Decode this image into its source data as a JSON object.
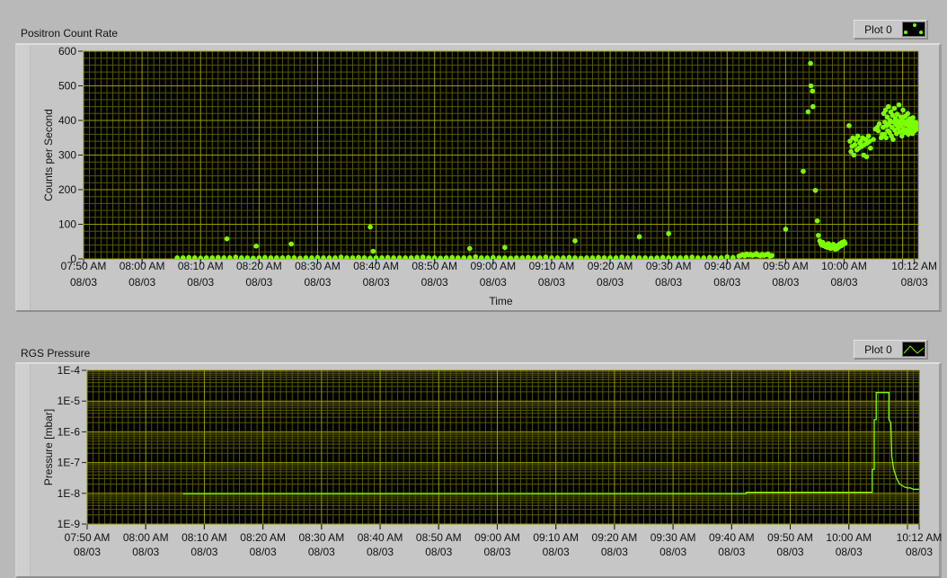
{
  "charts": [
    {
      "title": "Positron Count Rate",
      "legend": {
        "label": "Plot 0",
        "icon": "scatter-points-icon"
      },
      "colors": {
        "plot": "#7cff00",
        "major_grid": "#9c9c00",
        "minor_grid": "#575700",
        "background": "#000000"
      }
    },
    {
      "title": "RGS Pressure",
      "legend": {
        "label": "Plot 0",
        "icon": "line-icon"
      },
      "colors": {
        "plot": "#7cff00",
        "major_grid": "#9c9c00",
        "minor_grid": "#575700",
        "background": "#000000"
      }
    }
  ],
  "chart_data": [
    {
      "type": "scatter",
      "title": "Positron Count Rate",
      "xlabel": "Time",
      "ylabel": "Counts per Second",
      "xlim": [
        "07:50:00",
        "10:12:40"
      ],
      "ylim": [
        0,
        600
      ],
      "y_scale": "linear",
      "y_ticks": [
        "0",
        "100",
        "200",
        "300",
        "400",
        "500",
        "600"
      ],
      "x_ticks": [
        {
          "time": "07:50 AM",
          "date": "08/03"
        },
        {
          "time": "08:00 AM",
          "date": "08/03"
        },
        {
          "time": "08:10 AM",
          "date": "08/03"
        },
        {
          "time": "08:20 AM",
          "date": "08/03"
        },
        {
          "time": "08:30 AM",
          "date": "08/03"
        },
        {
          "time": "08:40 AM",
          "date": "08/03"
        },
        {
          "time": "08:50 AM",
          "date": "08/03"
        },
        {
          "time": "09:00 AM",
          "date": "08/03"
        },
        {
          "time": "09:10 AM",
          "date": "08/03"
        },
        {
          "time": "09:20 AM",
          "date": "08/03"
        },
        {
          "time": "09:30 AM",
          "date": "08/03"
        },
        {
          "time": "09:40 AM",
          "date": "08/03"
        },
        {
          "time": "09:50 AM",
          "date": "08/03"
        },
        {
          "time": "10:00 AM",
          "date": "08/03"
        },
        {
          "time": "10:12 AM",
          "date": "08/03"
        }
      ],
      "grid": true,
      "legend_position": "top-right",
      "series": [
        {
          "name": "Plot 0",
          "regular_segments": [
            {
              "start": "08:06:00",
              "step_s": 60,
              "values": [
                3,
                3,
                4,
                3,
                2,
                3,
                3,
                4,
                3,
                3,
                5,
                3,
                3,
                2,
                3,
                4,
                3,
                3,
                3,
                4,
                3,
                2,
                3,
                3,
                4,
                3,
                3,
                3,
                5,
                3,
                3,
                4,
                3,
                2,
                3,
                3,
                4,
                3,
                3,
                3,
                3,
                4,
                5,
                3,
                3,
                2,
                3,
                4,
                3,
                3,
                3,
                6,
                3,
                3,
                4,
                3,
                3,
                2,
                3,
                3,
                4,
                3,
                3,
                5,
                3,
                3,
                3,
                4,
                3,
                2,
                3,
                3,
                4,
                3,
                3,
                3,
                5,
                3,
                4,
                3,
                3,
                2,
                3,
                4,
                3,
                3,
                3,
                4,
                5,
                3,
                3,
                4,
                3,
                3,
                6,
                4
              ]
            },
            {
              "start": "09:42:00",
              "step_s": 20,
              "values": [
                8,
                10,
                12,
                9,
                14,
                11,
                13,
                10,
                12,
                15,
                11,
                9,
                13,
                10,
                12,
                14,
                8,
                10
              ]
            },
            {
              "start": "10:06:40",
              "step_s": 6,
              "values": [
                380,
                420,
                360,
                395,
                430,
                350,
                385,
                410,
                370,
                440,
                390,
                365,
                400,
                425,
                355,
                380,
                415,
                345,
                395,
                435,
                372,
                405,
                388,
                362,
                418,
                398,
                378,
                445,
                392,
                368,
                410,
                385,
                355,
                402,
                430,
                375,
                395,
                365,
                412,
                388,
                372,
                398,
                420,
                360,
                392,
                380,
                405,
                370,
                398,
                385,
                362,
                408,
                392,
                378,
                370,
                395,
                385,
                375,
                390,
                380
              ]
            }
          ],
          "points": [
            [
              "08:14:30",
              58
            ],
            [
              "08:19:30",
              37
            ],
            [
              "08:25:30",
              43
            ],
            [
              "08:39:00",
              92
            ],
            [
              "08:39:30",
              22
            ],
            [
              "08:56:00",
              30
            ],
            [
              "09:02:00",
              33
            ],
            [
              "09:14:00",
              52
            ],
            [
              "09:25:00",
              64
            ],
            [
              "09:30:00",
              73
            ],
            [
              "09:50:00",
              86
            ],
            [
              "09:53:00",
              253
            ],
            [
              "09:53:50",
              425
            ],
            [
              "09:54:15",
              565
            ],
            [
              "09:54:20",
              500
            ],
            [
              "09:54:35",
              485
            ],
            [
              "09:54:40",
              440
            ],
            [
              "09:55:05",
              198
            ],
            [
              "09:55:25",
              110
            ],
            [
              "09:55:35",
              68
            ],
            [
              "09:55:50",
              52
            ],
            [
              "09:56:00",
              45
            ],
            [
              "09:56:10",
              40
            ],
            [
              "09:56:20",
              48
            ],
            [
              "09:56:30",
              38
            ],
            [
              "09:56:40",
              42
            ],
            [
              "09:56:50",
              35
            ],
            [
              "09:57:00",
              40
            ],
            [
              "09:57:10",
              33
            ],
            [
              "09:57:20",
              44
            ],
            [
              "09:57:30",
              36
            ],
            [
              "09:57:40",
              30
            ],
            [
              "09:57:50",
              38
            ],
            [
              "09:58:00",
              32
            ],
            [
              "09:58:10",
              42
            ],
            [
              "09:58:20",
              34
            ],
            [
              "09:58:30",
              28
            ],
            [
              "09:58:40",
              36
            ],
            [
              "09:58:50",
              30
            ],
            [
              "09:59:00",
              40
            ],
            [
              "09:59:10",
              35
            ],
            [
              "09:59:20",
              44
            ],
            [
              "09:59:30",
              38
            ],
            [
              "09:59:40",
              48
            ],
            [
              "09:59:50",
              42
            ],
            [
              "10:00:00",
              50
            ],
            [
              "10:00:10",
              45
            ],
            [
              "10:00:50",
              385
            ],
            [
              "10:01:00",
              340
            ],
            [
              "10:01:10",
              310
            ],
            [
              "10:01:20",
              325
            ],
            [
              "10:01:30",
              350
            ],
            [
              "10:01:40",
              300
            ],
            [
              "10:01:50",
              330
            ],
            [
              "10:02:00",
              345
            ],
            [
              "10:02:10",
              315
            ],
            [
              "10:02:20",
              355
            ],
            [
              "10:02:30",
              320
            ],
            [
              "10:02:40",
              335
            ],
            [
              "10:02:50",
              340
            ],
            [
              "10:03:00",
              325
            ],
            [
              "10:03:10",
              350
            ],
            [
              "10:03:20",
              300
            ],
            [
              "10:03:30",
              330
            ],
            [
              "10:03:40",
              345
            ],
            [
              "10:03:50",
              295
            ],
            [
              "10:04:00",
              335
            ],
            [
              "10:04:10",
              355
            ],
            [
              "10:04:20",
              340
            ],
            [
              "10:04:30",
              320
            ],
            [
              "10:05:00",
              345
            ],
            [
              "10:05:20",
              375
            ],
            [
              "10:05:40",
              380
            ],
            [
              "10:05:50",
              370
            ],
            [
              "10:06:00",
              390
            ],
            [
              "10:06:20",
              350
            ],
            [
              "10:06:30",
              360
            ]
          ]
        }
      ]
    },
    {
      "type": "line",
      "title": "RGS Pressure",
      "xlabel": "Time",
      "ylabel": "Pressure [mbar]",
      "xlim": [
        "07:50:00",
        "10:12:00"
      ],
      "ylim": [
        1e-09,
        0.0001
      ],
      "y_scale": "log",
      "y_ticks": [
        "1E-9",
        "1E-8",
        "1E-7",
        "1E-6",
        "1E-5",
        "1E-4"
      ],
      "x_ticks": [
        {
          "time": "07:50 AM",
          "date": "08/03"
        },
        {
          "time": "08:00 AM",
          "date": "08/03"
        },
        {
          "time": "08:10 AM",
          "date": "08/03"
        },
        {
          "time": "08:20 AM",
          "date": "08/03"
        },
        {
          "time": "08:30 AM",
          "date": "08/03"
        },
        {
          "time": "08:40 AM",
          "date": "08/03"
        },
        {
          "time": "08:50 AM",
          "date": "08/03"
        },
        {
          "time": "09:00 AM",
          "date": "08/03"
        },
        {
          "time": "09:10 AM",
          "date": "08/03"
        },
        {
          "time": "09:20 AM",
          "date": "08/03"
        },
        {
          "time": "09:30 AM",
          "date": "08/03"
        },
        {
          "time": "09:40 AM",
          "date": "08/03"
        },
        {
          "time": "09:50 AM",
          "date": "08/03"
        },
        {
          "time": "10:00 AM",
          "date": "08/03"
        },
        {
          "time": "10:12 AM",
          "date": "08/03"
        }
      ],
      "grid": true,
      "legend_position": "top-right",
      "series": [
        {
          "name": "Plot 0",
          "points": [
            [
              "08:06:20",
              9.8e-09
            ],
            [
              "09:42:30",
              9.8e-09
            ],
            [
              "09:42:30",
              1.08e-08
            ],
            [
              "10:04:00",
              1.08e-08
            ],
            [
              "10:04:00",
              6e-08
            ],
            [
              "10:04:20",
              6e-08
            ],
            [
              "10:04:20",
              2.5e-06
            ],
            [
              "10:04:40",
              2.5e-06
            ],
            [
              "10:04:40",
              1.9e-05
            ],
            [
              "10:06:50",
              1.9e-05
            ],
            [
              "10:06:50",
              2.5e-06
            ],
            [
              "10:07:10",
              2e-06
            ],
            [
              "10:07:20",
              1.5e-07
            ],
            [
              "10:07:40",
              6e-08
            ],
            [
              "10:08:10",
              3e-08
            ],
            [
              "10:08:40",
              2e-08
            ],
            [
              "10:09:30",
              1.6e-08
            ],
            [
              "10:10:00",
              1.5e-08
            ],
            [
              "10:10:30",
              1.5e-08
            ],
            [
              "10:11:00",
              1.35e-08
            ],
            [
              "10:12:00",
              1.35e-08
            ]
          ]
        }
      ]
    }
  ]
}
